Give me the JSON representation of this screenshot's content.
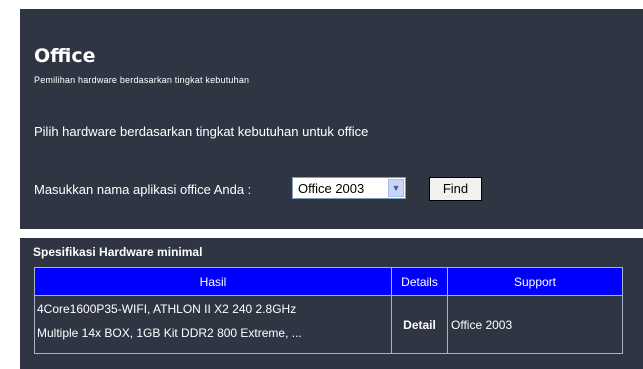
{
  "header": {
    "title": "Office",
    "subtitle": "Pemilihan hardware berdasarkan tingkat kebutuhan"
  },
  "intro": "Pilih hardware berdasarkan tingkat kebutuhan untuk office",
  "form": {
    "label": "Masukkan nama aplikasi office Anda :",
    "select_value": "Office 2003",
    "find_label": "Find"
  },
  "specs": {
    "title": "Spesifikasi Hardware minimal",
    "columns": [
      "Hasil",
      "Details",
      "Support"
    ],
    "rows": [
      {
        "hasil_line1": "4Core1600P35-WIFI, ATHLON II X2 240 2.8GHz",
        "hasil_line2": "Multiple 14x BOX, 1GB Kit DDR2 800 Extreme, ...",
        "detail": "Detail",
        "support": "Office 2003"
      }
    ]
  },
  "colors": {
    "panel_bg": "#2f3543",
    "table_header_bg": "#0000ff",
    "text": "#ffffff"
  },
  "icons": {
    "select_arrow": "chevron-down-icon"
  }
}
